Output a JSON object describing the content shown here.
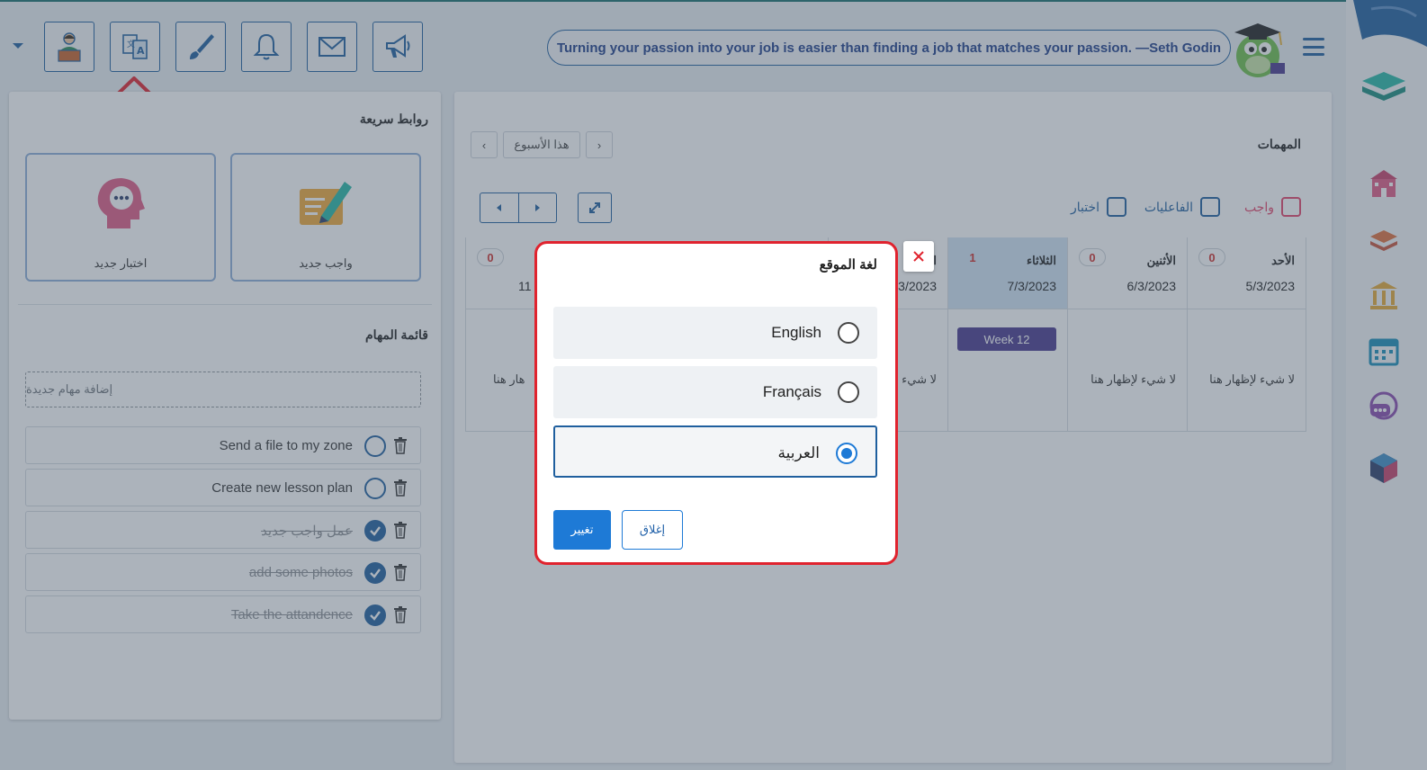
{
  "header": {
    "quote": "Turning your passion into your job is easier than finding a job that matches your passion. —Seth Godin",
    "toolbar_icons": [
      "teacher-profile-icon",
      "language-translate-icon",
      "paint-brush-icon",
      "bell-icon",
      "mail-icon",
      "megaphone-icon"
    ]
  },
  "sidebar_right": {
    "icons": [
      "school-icon",
      "books-icon",
      "institution-icon",
      "calendar-icon",
      "chat-icon",
      "package-icon"
    ]
  },
  "quick_links": {
    "title": "روابط سريعة",
    "cards": [
      {
        "label": "اختبار جديد",
        "icon": "question-head-icon"
      },
      {
        "label": "واجب جديد",
        "icon": "pen-paper-icon"
      }
    ]
  },
  "task_list": {
    "title": "قائمة المهام",
    "add_placeholder": "إضافة مهام جديدة",
    "items": [
      {
        "text": "Send a file to my zone",
        "done": false
      },
      {
        "text": "Create new lesson plan",
        "done": false
      },
      {
        "text": "عمل واجب جديد",
        "done": true
      },
      {
        "text": "add some photos",
        "done": true
      },
      {
        "text": "Take the attandence",
        "done": true
      }
    ]
  },
  "calendar": {
    "title": "المهمات",
    "week_label": "هذا الأسبوع",
    "filters": [
      {
        "label": "واجب",
        "color": "#e3446a"
      },
      {
        "label": "الفاعليات",
        "color": "#1f5f9e"
      },
      {
        "label": "اختبار",
        "color": "#1f5f9e"
      }
    ],
    "days": [
      {
        "name": "الأحد",
        "date": "5/3/2023",
        "count": "0",
        "empty": "لا شيء لإظهار هنا"
      },
      {
        "name": "الأثنين",
        "date": "6/3/2023",
        "count": "0",
        "empty": "لا شيء لإظهار هنا"
      },
      {
        "name": "الثلاثاء",
        "date": "7/3/2023",
        "count": "1",
        "badge": "Week 12"
      },
      {
        "name": "ال",
        "date": "3/2023",
        "empty": "لا شيء لإ"
      },
      {
        "name": "",
        "date": "11",
        "count": "0",
        "empty": "هار هنا"
      }
    ]
  },
  "modal": {
    "title": "لغة الموقع",
    "options": [
      {
        "label": "English",
        "selected": false
      },
      {
        "label": "Français",
        "selected": false
      },
      {
        "label": "العربية",
        "selected": true
      }
    ],
    "apply_label": "تغيير",
    "close_label": "إغلاق"
  },
  "colors": {
    "accent": "#1f5f9e",
    "danger": "#e0232e",
    "primary": "#1e7ad6",
    "week_badge": "#4a3a8e"
  }
}
